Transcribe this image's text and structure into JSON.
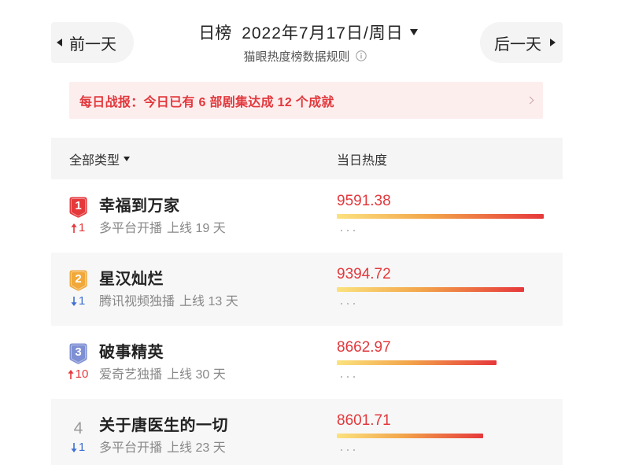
{
  "header": {
    "prev_day": "前一天",
    "next_day": "后一天",
    "board_type": "日榜",
    "date": "2022年7月17日/周日",
    "rules_link": "猫眼热度榜数据规则",
    "icons": {
      "prev": "triangle-left-icon",
      "next": "triangle-right-icon",
      "date_dropdown": "caret-down-icon",
      "rules_info": "info-circle-icon"
    }
  },
  "banner": {
    "text": "每日战报：今日已有 6 部剧集达成 12 个成就",
    "icon": "chevron-right-icon"
  },
  "table": {
    "filter_label": "全部类型",
    "filter_icon": "caret-down-icon",
    "heat_column": "当日热度",
    "row_more_icon": "more-dots-icon"
  },
  "rows": [
    {
      "rank": "1",
      "badge_color": "#e5383b",
      "change_icon": "arrow-up-icon",
      "change": "1",
      "title": "幸福到万家",
      "platform": "多平台开播",
      "online": "上线 19 天",
      "heat": "9591.38",
      "heat_bar_fraction": 1.0
    },
    {
      "rank": "2",
      "badge_color": "#f1a83a",
      "change_icon": "arrow-down-icon",
      "change": "1",
      "title": "星汉灿烂",
      "platform": "腾讯视频独播",
      "online": "上线 13 天",
      "heat": "9394.72",
      "heat_bar_fraction": 0.905
    },
    {
      "rank": "3",
      "badge_color": "#7e8fd3",
      "change_icon": "arrow-up-icon",
      "change": "10",
      "title": "破事精英",
      "platform": "爱奇艺独播",
      "online": "上线 30 天",
      "heat": "8662.97",
      "heat_bar_fraction": 0.772
    },
    {
      "rank": "4",
      "badge_color": null,
      "change_icon": "arrow-down-icon",
      "change": "1",
      "title": "关于唐医生的一切",
      "platform": "多平台开播",
      "online": "上线 23 天",
      "heat": "8601.71",
      "heat_bar_fraction": 0.707
    }
  ],
  "colors": {
    "heat_text": "#e2383c",
    "banner_text": "#e2383c",
    "banner_bg": "#fdeeee",
    "rank_up": "#e5383b",
    "rank_down": "#3d6fd3",
    "rank_plain": "#9a9a9a",
    "heat_bar_start": "#fbe27e",
    "heat_bar_mid": "#f3a54b",
    "heat_bar_end": "#e6383b"
  }
}
